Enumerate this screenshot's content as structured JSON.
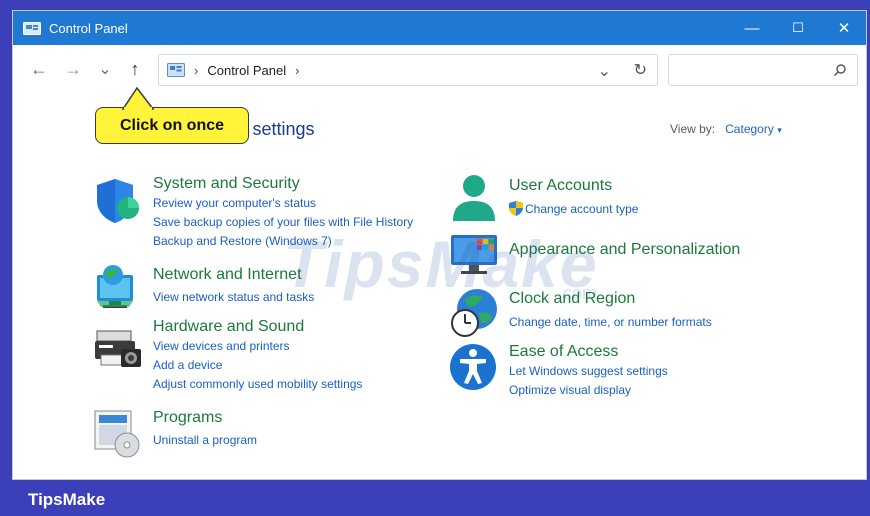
{
  "window": {
    "title": "Control Panel"
  },
  "titlebar": {
    "minimize": "—",
    "maximize": "☐",
    "close": "✕"
  },
  "nav": {
    "back": "←",
    "forward": "→",
    "recent": "⌄",
    "up": "↑"
  },
  "address": {
    "crumb": "Control Panel",
    "sep1": "›",
    "sep2": "›",
    "dropdown": "⌄",
    "refresh": "↻"
  },
  "search": {
    "placeholder": ""
  },
  "callout": {
    "text": "Click on once"
  },
  "main": {
    "heading": "'s settings",
    "view_by_label": "View by:",
    "view_by_value": "Category",
    "view_by_caret": "▾"
  },
  "categories": [
    {
      "title": "System and Security",
      "links": [
        "Review your computer's status",
        "Save backup copies of your files with File History",
        "Backup and Restore (Windows 7)"
      ]
    },
    {
      "title": "Network and Internet",
      "links": [
        "View network status and tasks"
      ]
    },
    {
      "title": "Hardware and Sound",
      "links": [
        "View devices and printers",
        "Add a device",
        "Adjust commonly used mobility settings"
      ]
    },
    {
      "title": "Programs",
      "links": [
        "Uninstall a program"
      ]
    },
    {
      "title": "User Accounts",
      "links": [
        "Change account type"
      ]
    },
    {
      "title": "Appearance and Personalization",
      "links": []
    },
    {
      "title": "Clock and Region",
      "links": [
        "Change date, time, or number formats"
      ]
    },
    {
      "title": "Ease of Access",
      "links": [
        "Let Windows suggest settings",
        "Optimize visual display"
      ]
    }
  ],
  "watermark": {
    "text": "TipsMake",
    "suffix": ".com"
  },
  "footer": {
    "brand": "TipsMake"
  },
  "colors": {
    "titlebar": "#1f78d1",
    "frame": "#3b3fb8",
    "category_title": "#1b7a3a",
    "link": "#1a5fc4",
    "callout": "#fff43a"
  }
}
